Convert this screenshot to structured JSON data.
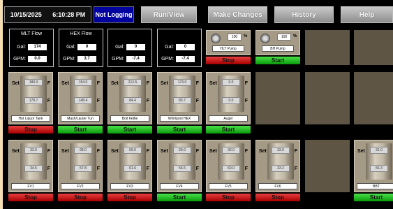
{
  "header": {
    "date": "10/15/2025",
    "time": "6:10:28 PM",
    "logging_status": "Not Logging",
    "nav": [
      "Run/View",
      "Make Changes",
      "History",
      "Help"
    ]
  },
  "flow_panels": [
    {
      "title": "MLT Flow",
      "gal_label": "Gal:",
      "gal": "174",
      "gpm_label": "GPM:",
      "gpm": "0.0"
    },
    {
      "title": "HEX Flow",
      "gal_label": "Gal:",
      "gal": "0",
      "gpm_label": "GPM:",
      "gpm": "3.7"
    },
    {
      "title": "",
      "gal_label": "Gal:",
      "gal": "0",
      "gpm_label": "GPM:",
      "gpm": "-7.4"
    },
    {
      "title": "",
      "gal_label": "Gal:",
      "gal": "0",
      "gpm_label": "GPM:",
      "gpm": "-7.4"
    }
  ],
  "pumps": [
    {
      "name": "HLT Pump",
      "percent": "100",
      "unit": "%",
      "button": "Stop",
      "state": "stop"
    },
    {
      "name": "BH Pump",
      "percent": "100",
      "unit": "%",
      "button": "Start",
      "state": "start"
    }
  ],
  "vessels_row1": [
    {
      "name": "Hot Liquor Tank",
      "set_label": "Set",
      "setpoint": "180.0",
      "actual": "178.7",
      "unit": "F",
      "button": "Stop",
      "state": "stop"
    },
    {
      "name": "Mash/Lauter Tun",
      "set_label": "Set",
      "setpoint": "154.0",
      "actual": "148.4",
      "unit": "F",
      "button": "Start",
      "state": "start"
    },
    {
      "name": "Boil Kettle",
      "set_label": "Set",
      "setpoint": "212.5",
      "actual": "84.4",
      "unit": "F",
      "button": "Start",
      "state": "start"
    },
    {
      "name": "Whirlpool HEX",
      "set_label": "Set",
      "setpoint": "173.0",
      "actual": "83.7",
      "unit": "F",
      "button": "Start",
      "state": "start"
    },
    {
      "name": "Auger",
      "set_label": "Set",
      "setpoint": "0.0",
      "actual": "0.0",
      "unit": "F",
      "button": "Start",
      "state": "start"
    }
  ],
  "vessels_row2": [
    {
      "name": "FV1",
      "set_label": "Set",
      "setpoint": "33.0",
      "actual": "34.5",
      "unit": "F",
      "button": "Stop",
      "state": "stop"
    },
    {
      "name": "FV2",
      "set_label": "Set",
      "setpoint": "68.0",
      "actual": "57.8",
      "unit": "F",
      "button": "Stop",
      "state": "stop"
    },
    {
      "name": "FV3",
      "set_label": "Set",
      "setpoint": "69.0",
      "actual": "61.6",
      "unit": "F",
      "button": "Stop",
      "state": "stop"
    },
    {
      "name": "FV4",
      "set_label": "Set",
      "setpoint": "69.0",
      "actual": "56.5",
      "unit": "F",
      "button": "Start",
      "state": "start"
    },
    {
      "name": "FV5",
      "set_label": "Set",
      "setpoint": "33.0",
      "actual": "60.0",
      "unit": "F",
      "button": "Stop",
      "state": "stop"
    },
    {
      "name": "FV6",
      "set_label": "Set",
      "setpoint": "33.0",
      "actual": "33.2",
      "unit": "F",
      "button": "Stop",
      "state": "stop"
    },
    {
      "name": "BBT",
      "set_label": "Set",
      "setpoint": "31.0",
      "actual": "56.3",
      "unit": "F",
      "button": "Start",
      "state": "start"
    }
  ],
  "colors": {
    "stop": "#c81010",
    "start": "#14b814",
    "logging": "#0000a0",
    "background": "#000000"
  }
}
